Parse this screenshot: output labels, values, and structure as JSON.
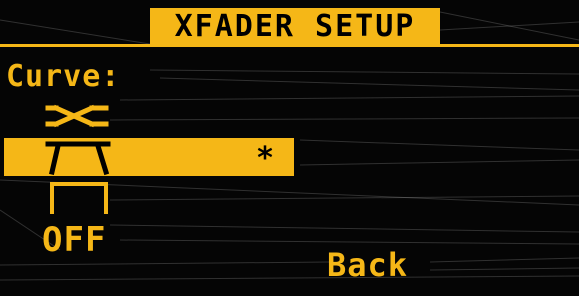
{
  "screen": {
    "title": "XFADER SETUP",
    "curve_label": "Curve:",
    "options": [
      {
        "icon": "crossover-curve-icon",
        "label": "",
        "selected": false
      },
      {
        "icon": "fast-cut-curve-icon",
        "label": "",
        "selected": true,
        "marker": "*"
      },
      {
        "icon": "sharp-cut-curve-icon",
        "label": "",
        "selected": false
      },
      {
        "icon": "",
        "label": "OFF",
        "selected": false
      }
    ],
    "back_label": "Back"
  },
  "colors": {
    "accent": "#f5b717",
    "background": "#050505",
    "text_on_accent": "#000000"
  }
}
